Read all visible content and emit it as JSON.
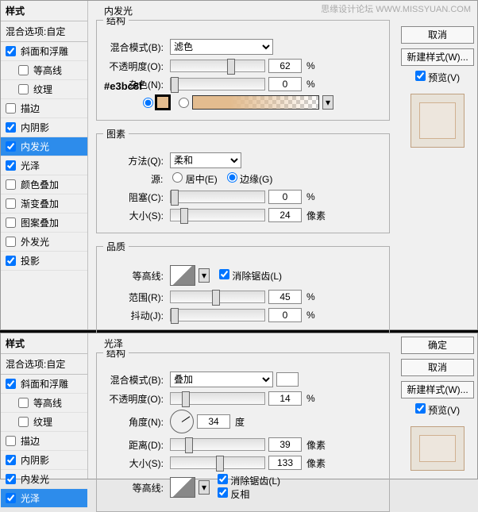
{
  "watermark": "思缘设计论坛 WWW.MISSYUAN.COM",
  "sidebar": {
    "header": "样式",
    "blend": "混合选项:自定",
    "items": [
      {
        "label": "斜面和浮雕",
        "checked": true,
        "indent": false
      },
      {
        "label": "等高线",
        "checked": false,
        "indent": true
      },
      {
        "label": "纹理",
        "checked": false,
        "indent": true
      },
      {
        "label": "描边",
        "checked": false,
        "indent": false
      },
      {
        "label": "内阴影",
        "checked": true,
        "indent": false
      },
      {
        "label": "内发光",
        "checked": true,
        "indent": false
      },
      {
        "label": "光泽",
        "checked": true,
        "indent": false
      },
      {
        "label": "颜色叠加",
        "checked": false,
        "indent": false
      },
      {
        "label": "渐变叠加",
        "checked": false,
        "indent": false
      },
      {
        "label": "图案叠加",
        "checked": false,
        "indent": false
      },
      {
        "label": "外发光",
        "checked": false,
        "indent": false
      },
      {
        "label": "投影",
        "checked": true,
        "indent": false
      }
    ]
  },
  "panel1": {
    "title": "内发光",
    "struct": {
      "legend": "结构",
      "blendMode": {
        "label": "混合模式(B):",
        "value": "滤色"
      },
      "opacity": {
        "label": "不透明度(O):",
        "value": "62",
        "unit": "%"
      },
      "noise": {
        "label": "杂色(N):",
        "value": "0",
        "unit": "%"
      },
      "colorNote": "#e3bc8f"
    },
    "elements": {
      "legend": "图素",
      "technique": {
        "label": "方法(Q):",
        "value": "柔和"
      },
      "sourceLabel": "源:",
      "sourceCenter": "居中(E)",
      "sourceEdge": "边缘(G)",
      "choke": {
        "label": "阻塞(C):",
        "value": "0",
        "unit": "%"
      },
      "size": {
        "label": "大小(S):",
        "value": "24",
        "unit": "像素"
      }
    },
    "quality": {
      "legend": "品质",
      "contourLabel": "等高线:",
      "antiAlias": "消除锯齿(L)",
      "range": {
        "label": "范围(R):",
        "value": "45",
        "unit": "%"
      },
      "jitter": {
        "label": "抖动(J):",
        "value": "0",
        "unit": "%"
      }
    }
  },
  "panel2": {
    "title": "光泽",
    "struct": {
      "legend": "结构",
      "blendMode": {
        "label": "混合模式(B):",
        "value": "叠加"
      },
      "opacity": {
        "label": "不透明度(O):",
        "value": "14",
        "unit": "%"
      },
      "angle": {
        "label": "角度(N):",
        "value": "34",
        "unit": "度"
      },
      "distance": {
        "label": "距离(D):",
        "value": "39",
        "unit": "像素"
      },
      "size": {
        "label": "大小(S):",
        "value": "133",
        "unit": "像素"
      },
      "contourLabel": "等高线:",
      "antiAlias": "消除锯齿(L)",
      "invert": "反相"
    }
  },
  "buttons": {
    "ok": "确定",
    "cancel": "取消",
    "newStyle": "新建样式(W)...",
    "preview": "预览(V)"
  }
}
